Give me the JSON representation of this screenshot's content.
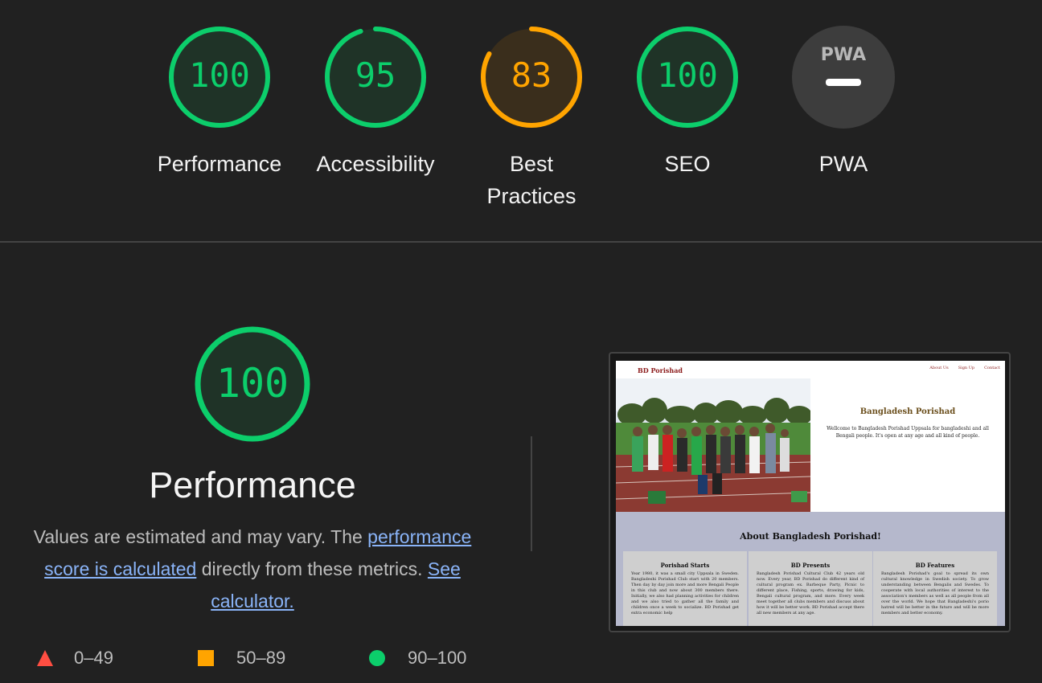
{
  "gauges": [
    {
      "score": "100",
      "label": "Performance",
      "value": 100,
      "color": "#0cce6b",
      "fill": "#1f3327"
    },
    {
      "score": "95",
      "label": "Accessibility",
      "value": 95,
      "color": "#0cce6b",
      "fill": "#1f3327"
    },
    {
      "score": "83",
      "label_line1": "Best",
      "label_line2": "Practices",
      "value": 83,
      "color": "#ffa400",
      "fill": "#3a2e1c"
    },
    {
      "score": "100",
      "label": "SEO",
      "value": 100,
      "color": "#0cce6b",
      "fill": "#1f3327"
    },
    {
      "badge": "PWA",
      "label": "PWA",
      "value": null,
      "color": "#5f5f5f",
      "fill": "#3d3d3d"
    }
  ],
  "performance": {
    "score": "100",
    "title": "Performance",
    "desc_prefix": "Values are estimated and may vary. The ",
    "desc_link1": "performance score is calculated",
    "desc_middle": " directly from these metrics. ",
    "desc_link2": "See calculator."
  },
  "legend": [
    {
      "range": "0–49",
      "icon": "triangle-icon",
      "color": "#ff4e42"
    },
    {
      "range": "50–89",
      "icon": "square-icon",
      "color": "#ffa400"
    },
    {
      "range": "90–100",
      "icon": "circle-icon",
      "color": "#0cce6b"
    }
  ],
  "screenshot": {
    "brand": "BD Porishad",
    "nav_links": [
      "About Us",
      "Sign Up",
      "Contact"
    ],
    "hero_title": "Bangladesh Porishad",
    "hero_text": "Wellcome to Bangladesh Porishad Uppsala for bangladeshi and all Bengali people. It's open at any age and all kind of people.",
    "about_title": "About Bangladesh Porishad!",
    "cards": [
      {
        "title": "Porishad Starts",
        "text": "Year 1980, it was a small city Uppsala in Sweden. Bangladeshi Porishad Club start with 20 members. Then day by day join more and more Bengali People in this club and now about 300 members there. Initially, we also had planning activities for children and we also tried to gather all the family and children once a week to socialize. BD Porishad get extra economic help"
      },
      {
        "title": "BD Presents",
        "text": "Bangladesh Porishad Cultural Club 42 years old now. Every year, BD Porishad do different kind of cultural program ex. Barbeque Party, Picnic to different place, Fishing, sports, drawing for kids, Bengali cultural program, and more. Every week meet together all clubs members and discuss about how it will be better work. BD Porishad accept there all new members at any age."
      },
      {
        "title": "BD Features",
        "text": "Bangladesh Porishad's goal to spread its own cultural knowledge in Swedish society. To grow understanding between Bengalis and Swedes. To cooperate with local authorities of interest to the association's members as well as all people from all over the world. We hope that Bangladeshi's porio hatred will be better in the future and will be more members and better economy."
      }
    ]
  }
}
